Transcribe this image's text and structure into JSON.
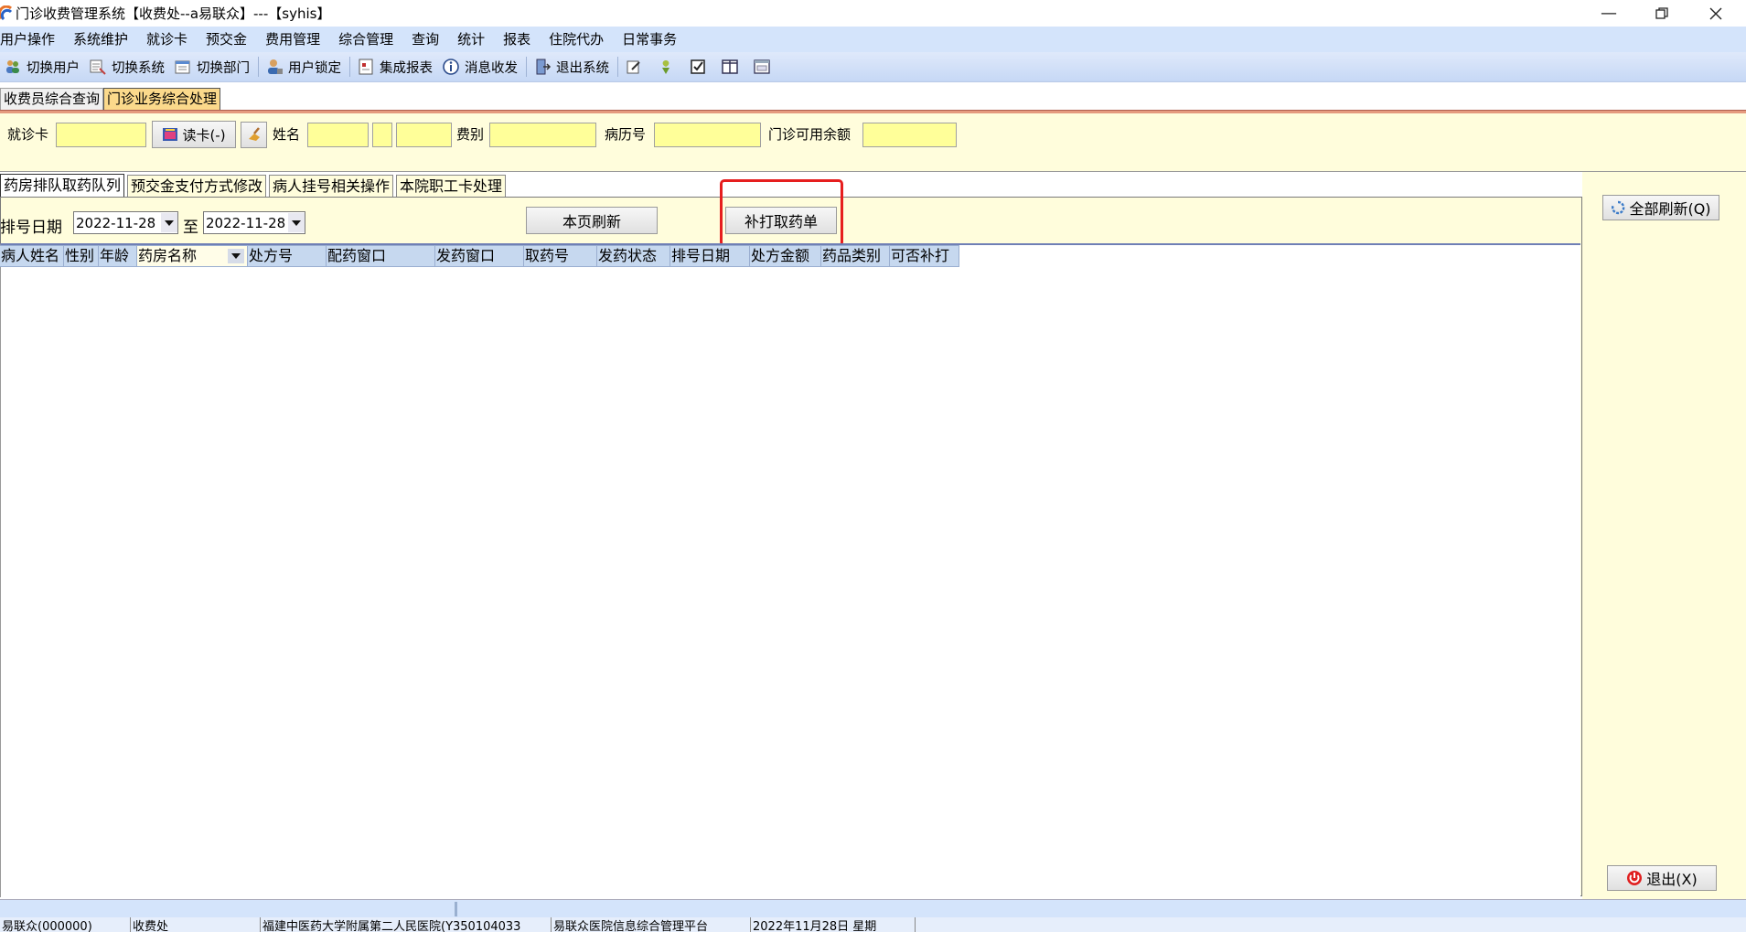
{
  "window": {
    "title": "门诊收费管理系统【收费处--a易联众】---【syhis】"
  },
  "menu": [
    "用户操作",
    "系统维护",
    "就诊卡",
    "预交金",
    "费用管理",
    "综合管理",
    "查询",
    "统计",
    "报表",
    "住院代办",
    "日常事务"
  ],
  "toolbar": {
    "switch_user": "切换用户",
    "switch_system": "切换系统",
    "switch_dept": "切换部门",
    "lock_user": "用户锁定",
    "integrated_report": "集成报表",
    "messages": "消息收发",
    "exit_system": "退出系统"
  },
  "top_tabs": [
    "收费员综合查询",
    "门诊业务综合处理"
  ],
  "patient": {
    "card_label": "就诊卡",
    "card_value": "",
    "read_card_label": "读卡(-)",
    "name_label": "姓名",
    "name_value": "",
    "fee_type_label": "费别",
    "fee_type_value": "",
    "record_no_label": "病历号",
    "record_no_value": "",
    "balance_label": "门诊可用余额",
    "balance_value": ""
  },
  "sub_tabs": [
    "药房排队取药队列",
    "预交金支付方式修改",
    "病人挂号相关操作",
    "本院职工卡处理"
  ],
  "filters": {
    "date_label": "排号日期",
    "date_from": "2022-11-28",
    "to_label": "至",
    "date_to": "2022-11-28",
    "refresh_page_label": "本页刷新",
    "reprint_label": "补打取药单"
  },
  "right_panel": {
    "refresh_all_label": "全部刷新(Q)",
    "exit_label": "退出(X)"
  },
  "grid": {
    "columns": [
      "病人姓名",
      "性别",
      "年龄",
      "药房名称",
      "处方号",
      "配药窗口",
      "发药窗口",
      "取药号",
      "发药状态",
      "排号日期",
      "处方金额",
      "药品类别",
      "可否补打"
    ],
    "rows": []
  },
  "status_bar": [
    "易联众(000000)",
    "收费处",
    "福建中医药大学附属第二人民医院(Y350104033",
    "易联众医院信息综合管理平台",
    "2022年11月28日 星期"
  ],
  "colors": {
    "highlight": "#e61e1e",
    "active_tab": "#fbd98b",
    "panel_bg": "#fffddc",
    "input_bg": "#ffff99"
  }
}
